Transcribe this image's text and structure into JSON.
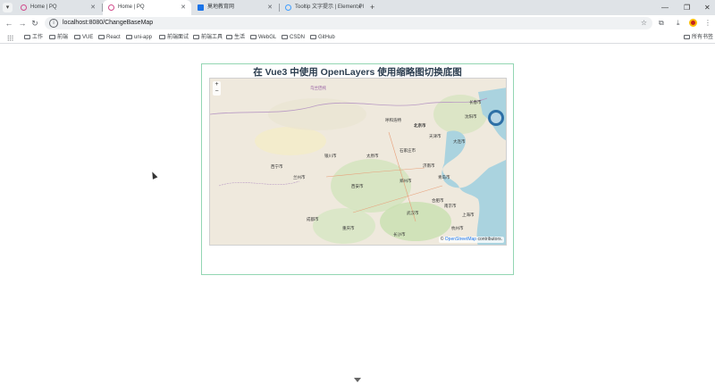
{
  "tabs": [
    {
      "title": "Home | PQ",
      "active": false
    },
    {
      "title": "Home | PQ",
      "active": true
    },
    {
      "title": "莫地教育网",
      "active": false
    },
    {
      "title": "Tooltip 文字提示 | Element Pl",
      "active": false
    }
  ],
  "toolbar": {
    "url": "localhost:8080/ChangeBaseMap"
  },
  "bookmarks": [
    "工作",
    "前端",
    "VUE",
    "React",
    "uni-app",
    "前端面试",
    "前端工具",
    "生活",
    "WebGL",
    "CSDN",
    "GitHub"
  ],
  "bookmarks_right": "所有书签",
  "page": {
    "title": "在 Vue3 中使用 OpenLayers 使用缩略图切换底图",
    "zoom_in": "+",
    "zoom_out": "−",
    "attribution_prefix": "©",
    "attribution_link": "OpenStreetMap",
    "attribution_suffix": "contributors."
  },
  "map_labels": [
    "乌兰巴托",
    "呼和浩特",
    "北京市",
    "天津市",
    "石家庄市",
    "太原市",
    "济南市",
    "郑州市",
    "西安市",
    "兰州市",
    "银川市",
    "西宁市",
    "武汉市",
    "南京市",
    "上海市",
    "合肥市",
    "成都市",
    "重庆市",
    "长沙市",
    "沈阳市",
    "长春市",
    "大连市",
    "青岛市",
    "杭州市"
  ],
  "colors": {
    "panel_border": "#93d6b3",
    "title": "#2c3e50",
    "water": "#aad3df",
    "land": "#efe9dd",
    "forest": "#c8e0b0"
  }
}
